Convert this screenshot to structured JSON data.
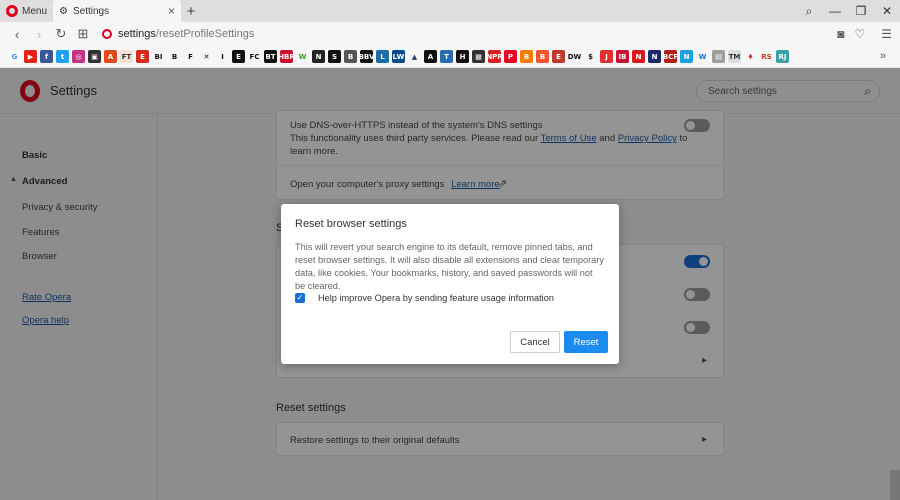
{
  "browser": {
    "menu_label": "Menu",
    "tab_title": "Settings",
    "new_tab": "+",
    "url_host": "settings",
    "url_path": "/resetProfileSettings"
  },
  "bookmarks": [
    {
      "label": "G",
      "color": "#ffffff",
      "fg": "#4285f4"
    },
    {
      "label": "▶",
      "color": "#e62117",
      "fg": "#ffffff"
    },
    {
      "label": "f",
      "color": "#3b5998",
      "fg": "#ffffff"
    },
    {
      "label": "t",
      "color": "#1da1f2",
      "fg": "#ffffff"
    },
    {
      "label": "◎",
      "color": "#c13584",
      "fg": "#ffffff"
    },
    {
      "label": "▣",
      "color": "#333333",
      "fg": "#ffffff"
    },
    {
      "label": "A",
      "color": "#e24a1b",
      "fg": "#ffffff"
    },
    {
      "label": "FT",
      "color": "#f2dfce",
      "fg": "#333333"
    },
    {
      "label": "E",
      "color": "#d52b1e",
      "fg": "#ffffff"
    },
    {
      "label": "BI",
      "color": "transparent",
      "fg": "#111111"
    },
    {
      "label": "B",
      "color": "transparent",
      "fg": "#111111"
    },
    {
      "label": "F",
      "color": "transparent",
      "fg": "#111111"
    },
    {
      "label": "✕",
      "color": "transparent",
      "fg": "#111111"
    },
    {
      "label": "I",
      "color": "transparent",
      "fg": "#111111"
    },
    {
      "label": "E",
      "color": "#111111",
      "fg": "#ffffff"
    },
    {
      "label": "FC",
      "color": "transparent",
      "fg": "#111111"
    },
    {
      "label": "BT",
      "color": "#111111",
      "fg": "#ffffff"
    },
    {
      "label": "HBR",
      "color": "#c8102e",
      "fg": "#ffffff"
    },
    {
      "label": "W",
      "color": "transparent",
      "fg": "#3a9d23"
    },
    {
      "label": "N",
      "color": "#222222",
      "fg": "#ffffff"
    },
    {
      "label": "S",
      "color": "#111111",
      "fg": "#ffffff"
    },
    {
      "label": "B",
      "color": "#555555",
      "fg": "#ffffff"
    },
    {
      "label": "BBV",
      "color": "#111111",
      "fg": "#ffffff"
    },
    {
      "label": "L",
      "color": "#1b6ca8",
      "fg": "#ffffff"
    },
    {
      "label": "LW",
      "color": "#0b4a8a",
      "fg": "#ffffff"
    },
    {
      "label": "▲",
      "color": "transparent",
      "fg": "#1f3d7a"
    },
    {
      "label": "A",
      "color": "#111111",
      "fg": "#ffffff"
    },
    {
      "label": "T",
      "color": "#2b6cb0",
      "fg": "#ffffff"
    },
    {
      "label": "H",
      "color": "#111111",
      "fg": "#ffffff"
    },
    {
      "label": "▦",
      "color": "#333333",
      "fg": "#ffffff"
    },
    {
      "label": "NPR",
      "color": "#d62021",
      "fg": "#ffffff"
    },
    {
      "label": "P",
      "color": "#e60023",
      "fg": "#ffffff"
    },
    {
      "label": "B",
      "color": "#f57d00",
      "fg": "#ffffff"
    },
    {
      "label": "B",
      "color": "#f2542d",
      "fg": "#ffffff"
    },
    {
      "label": "E",
      "color": "#c0392b",
      "fg": "#ffffff"
    },
    {
      "label": "DW",
      "color": "transparent",
      "fg": "#111111"
    },
    {
      "label": "$",
      "color": "transparent",
      "fg": "#111111"
    },
    {
      "label": "J",
      "color": "#e0302f",
      "fg": "#ffffff"
    },
    {
      "label": "IB",
      "color": "#c41230",
      "fg": "#ffffff"
    },
    {
      "label": "N",
      "color": "#d7191c",
      "fg": "#ffffff"
    },
    {
      "label": "N",
      "color": "#1a2a6c",
      "fg": "#ffffff"
    },
    {
      "label": "BCF",
      "color": "#b31b1b",
      "fg": "#ffffff"
    },
    {
      "label": "N",
      "color": "#1ba1e2",
      "fg": "#ffffff"
    },
    {
      "label": "W",
      "color": "transparent",
      "fg": "#1d6fd6"
    },
    {
      "label": "▤",
      "color": "#9e9e9e",
      "fg": "#ffffff"
    },
    {
      "label": "TM",
      "color": "#dddddd",
      "fg": "#333333"
    },
    {
      "label": "♦",
      "color": "transparent",
      "fg": "#c0392b"
    },
    {
      "label": "RS",
      "color": "transparent",
      "fg": "#c0392b"
    },
    {
      "label": "RJ",
      "color": "#3aa0a8",
      "fg": "#ffffff"
    }
  ],
  "settings_header": {
    "title": "Settings",
    "search_placeholder": "Search settings"
  },
  "sidebar": {
    "basic": "Basic",
    "advanced": "Advanced",
    "privacy": "Privacy & security",
    "features": "Features",
    "browser": "Browser",
    "rate_opera": "Rate Opera",
    "opera_help": "Opera help"
  },
  "main": {
    "dns_title": "Use DNS-over-HTTPS instead of the system's DNS settings",
    "dns_desc_1": "This functionality uses third party services. Please read our",
    "dns_terms": "Terms of Use",
    "dns_and": "and",
    "dns_privacy": "Privacy Policy",
    "dns_to": "to",
    "dns_desc_2": "learn more.",
    "proxy_text": "Open your computer's proxy settings",
    "proxy_link": "Learn more",
    "partial_heading": "S",
    "reset_heading": "Reset settings",
    "restore_row": "Restore settings to their original defaults"
  },
  "dialog": {
    "title": "Reset browser settings",
    "body": "This will revert your search engine to its default, remove pinned tabs, and reset browser settings. It will also disable all extensions and clear temporary data, like cookies. Your bookmarks, history, and saved passwords will not be cleared.",
    "checkbox_label": "Help improve Opera by sending feature usage information",
    "checkbox_checked": true,
    "cancel_label": "Cancel",
    "reset_label": "Reset",
    "accent": "#1c8bf0"
  }
}
